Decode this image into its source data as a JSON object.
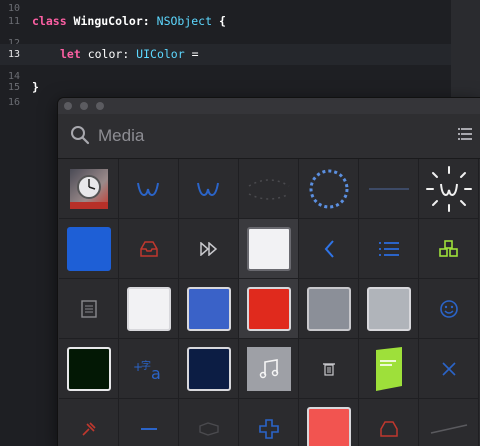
{
  "editor": {
    "lines": [
      {
        "num": "10",
        "code_kw": "",
        "code_rest": ""
      },
      {
        "num": "11",
        "kw": "class",
        "name": " WinguColor:",
        "type": " NSObject",
        "tail": " {"
      },
      {
        "num": "12"
      },
      {
        "num": "13",
        "kw": "let",
        "name": " color:",
        "type": " UIColor",
        "tail": " ="
      },
      {
        "num": "14"
      },
      {
        "num": "15",
        "tail": "}"
      },
      {
        "num": "16"
      }
    ]
  },
  "panel": {
    "search_placeholder": "Media"
  },
  "colors": {
    "keyword": "#fc5fa3",
    "type": "#5dd8ff",
    "blue_swatch": "#1e5fd6",
    "white_swatch": "#f2f2f4",
    "mid_blue_swatch": "#3a62c8",
    "red_swatch": "#e02a1d",
    "gray_swatch": "#8b8f98",
    "light_gray_swatch": "#b0b4ba",
    "dark_green_swatch": "#031805",
    "navy_swatch": "#0c1d44",
    "coral_swatch": "#f25450",
    "lime": "#9ee03a",
    "icon_blue": "#2b64c8",
    "icon_red": "#c0382e"
  },
  "icons": [
    "photo-thumbnail",
    "wingu-logo-icon",
    "wingu-logo-icon",
    "dotted-arc-icon",
    "spinner-dots-icon",
    "line-icon",
    "wingu-sun-icon",
    "blue-swatch",
    "inbox-icon",
    "fast-forward-icon",
    "white-swatch",
    "chevron-left-icon",
    "list-icon",
    "cubes-icon",
    "document-icon",
    "white-swatch",
    "blue-swatch",
    "red-swatch",
    "gray-swatch",
    "light-gray-swatch",
    "smiley-icon",
    "dark-green-swatch",
    "translate-icon",
    "navy-swatch",
    "music-note-image",
    "trash-icon",
    "green-flag-image",
    "close-x-icon",
    "red-pin-icon",
    "minus-icon",
    "outline-shape-icon",
    "plus-cross-icon",
    "coral-swatch",
    "inbox-red-icon",
    "slash-line-icon"
  ]
}
